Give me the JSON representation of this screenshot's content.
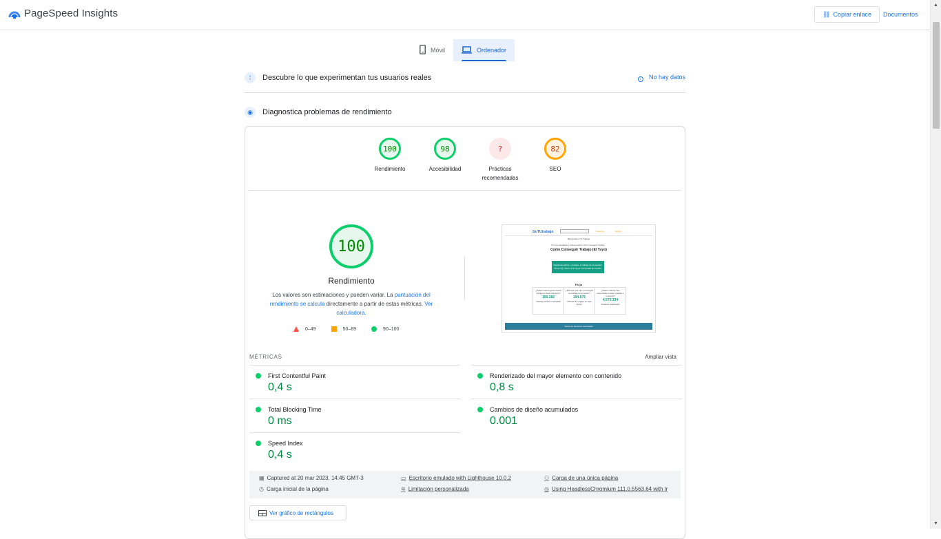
{
  "header": {
    "app_name": "PageSpeed Insights",
    "copy_link_label": "Copiar enlace",
    "docs_label": "Documentos"
  },
  "tabs": [
    {
      "label": "Móvil",
      "icon": "phone-icon",
      "active": false
    },
    {
      "label": "Ordenador",
      "icon": "laptop-icon",
      "active": true
    }
  ],
  "field_section": {
    "title": "Descubre lo que experimentan tus usuarios reales",
    "no_data_label": "No hay datos"
  },
  "lab_section": {
    "title": "Diagnostica problemas de rendimiento"
  },
  "scores": [
    {
      "value": "100",
      "label": "Rendimiento",
      "status": "good",
      "color": "#0cce6b"
    },
    {
      "value": "98",
      "label": "Accesibilidad",
      "status": "good",
      "color": "#0cce6b"
    },
    {
      "value": "?",
      "label": "Prácticas recomendadas",
      "status": "error",
      "color": "#c5221f"
    },
    {
      "value": "82",
      "label": "SEO",
      "status": "average",
      "color": "#ffa400"
    }
  ],
  "performance": {
    "score": "100",
    "label": "Rendimiento",
    "desc_before": "Los valores son estimaciones y pueden variar. La ",
    "desc_link1": "puntuación del rendimiento se calcula",
    "desc_middle": " directamente a partir de estas métricas. ",
    "desc_link2": "Ver calculadora.",
    "legend": [
      {
        "range": "0–49",
        "shape": "triangle",
        "color": "#ff4e42"
      },
      {
        "range": "50–89",
        "shape": "square",
        "color": "#ffa400"
      },
      {
        "range": "90–100",
        "shape": "circle",
        "color": "#0cce6b"
      }
    ]
  },
  "screenshot_preview": {
    "brand": "GuTUtrabajo",
    "nav1": "Nosotros",
    "nav2": "Ayuda",
    "welcome": "Bienvenido a Tu Trabajo",
    "intro": "Si eres estudiante y quieres saber cómo conseguir trabajo...",
    "headline": "Como Conseguir Trabajo (El Tuyo)",
    "cta_text": "Regístrate ahora y consigue el trabajo de tus sueños. Únete hoy mismo a la mayor comunidad de empleo.",
    "faqs_title": "FAQs",
    "faq_cols": [
      {
        "q": "¿Sabes cuánta gente busca trabajo en este momento?",
        "n": "156.382",
        "note": "Ofertas activas en España"
      },
      {
        "q": "¿Piensas que vas a conseguir un trabajo en tu sector?",
        "n": "194.875",
        "note": "Ofertas de empleo en este sector"
      },
      {
        "q": "¿Sabes cuántos han encontrado empleo gracias a nosotros?",
        "n": "4.570.334",
        "note": "Usuarios registrados"
      }
    ],
    "footer": "Todos los derechos reservados"
  },
  "metrics": {
    "header": "MÉTRICAS",
    "expand_label": "Ampliar vista",
    "items": [
      {
        "name": "First Contentful Paint",
        "value": "0,4 s",
        "status": "good"
      },
      {
        "name": "Renderizado del mayor elemento con contenido",
        "value": "0,8 s",
        "status": "good"
      },
      {
        "name": "Total Blocking Time",
        "value": "0 ms",
        "status": "good"
      },
      {
        "name": "Cambios de diseño acumulados",
        "value": "0.001",
        "status": "good"
      },
      {
        "name": "Speed Index",
        "value": "0,4 s",
        "status": "good"
      }
    ]
  },
  "run_info": {
    "captured": "Captured at 20 mar 2023, 14:45 GMT-3",
    "emulated": "Escritorio emulado with Lighthouse 10.0.2",
    "single_page": "Carga de una única página",
    "initial_load": "Carga inicial de la página",
    "throttling": "Limitación personalizada",
    "browser": "Using HeadlessChromium 111.0.5563.64 with lr"
  },
  "treemap_label": "Ver gráfico de rectángulos",
  "colors": {
    "accent": "#1a73e8",
    "good": "#0cce6b",
    "average": "#ffa400",
    "poor": "#ff4e42"
  }
}
